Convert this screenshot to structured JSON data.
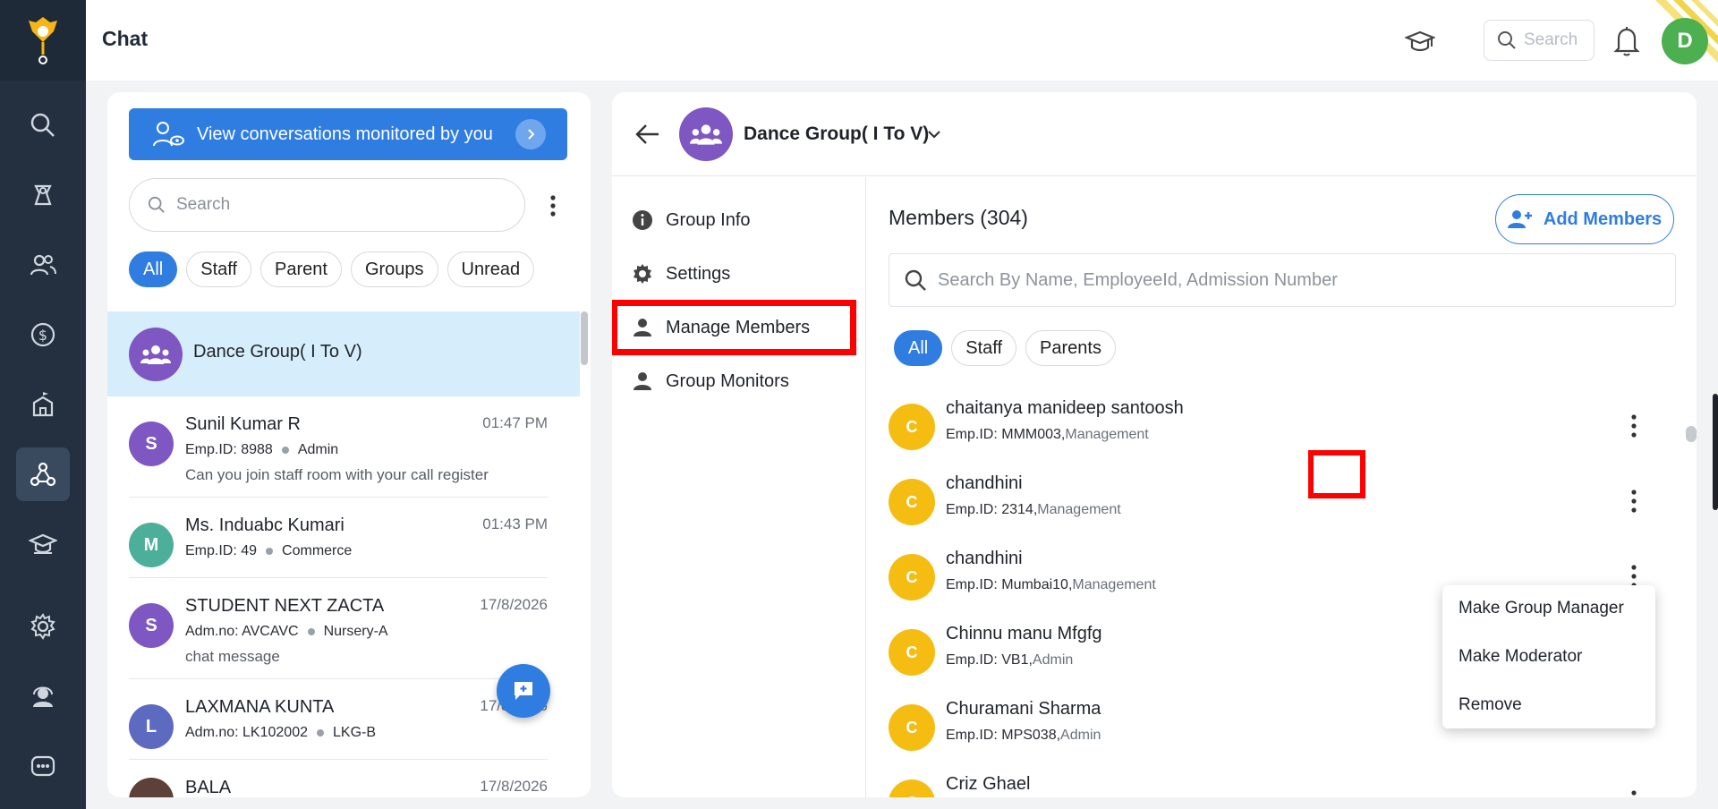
{
  "app": {
    "title": "Chat"
  },
  "topbar": {
    "search_placeholder": "Search",
    "avatar_letter": "D"
  },
  "rail": {
    "icons": [
      "search-icon",
      "study-icon",
      "people-icon",
      "finance-icon",
      "school-icon",
      "chat-network-icon",
      "graduation-icon",
      "settings-icon",
      "support-icon",
      "more-icon"
    ]
  },
  "chat_panel": {
    "monitor_label": "View conversations monitored by you",
    "search_placeholder": "Search",
    "filters": [
      "All",
      "Staff",
      "Parent",
      "Groups",
      "Unread"
    ],
    "items": [
      {
        "name": "Dance Group( I To V)",
        "selected": true
      },
      {
        "initial": "S",
        "name": "Sunil Kumar R",
        "id": "Emp.ID: 8988",
        "tag": "Admin",
        "message": "Can you join staff room with your call register",
        "time": "01:47 PM",
        "color": "#7e57c2"
      },
      {
        "initial": "M",
        "name": "Ms. Induabc Kumari",
        "id": "Emp.ID: 49",
        "tag": "Commerce",
        "message": "",
        "time": "01:43 PM",
        "color": "#4caf9a"
      },
      {
        "initial": "S",
        "name": "STUDENT NEXT ZACTA",
        "id": "Adm.no: AVCAVC",
        "tag": "Nursery-A",
        "message": "chat message",
        "time": "17/8/2026",
        "color": "#7e57c2"
      },
      {
        "initial": "L",
        "name": "LAXMANA KUNTA",
        "id": "Adm.no: LK102002",
        "tag": "LKG-B",
        "message": "",
        "time": "17/8/2026",
        "color": "#5c6bc0"
      },
      {
        "initial": "",
        "name": "BALA",
        "id": "",
        "tag": "",
        "message": "",
        "time": "17/8/2026",
        "color": "#5d4037"
      }
    ]
  },
  "group": {
    "title": "Dance Group( I To V)",
    "menu": [
      "Group Info",
      "Settings",
      "Manage Members",
      "Group Monitors"
    ],
    "members_title": "Members (304)",
    "add_members": "Add Members",
    "search_placeholder": "Search By Name, EmployeeId, Admission Number",
    "filters": [
      "All",
      "Staff",
      "Parents"
    ],
    "members": [
      {
        "initial": "C",
        "name": "chaitanya manideep santoosh",
        "id": "Emp.ID: MMM003,",
        "role": "Management"
      },
      {
        "initial": "C",
        "name": "chandhini",
        "id": "Emp.ID: 2314,",
        "role": "Management"
      },
      {
        "initial": "C",
        "name": "chandhini",
        "id": "Emp.ID: Mumbai10,",
        "role": "Management"
      },
      {
        "initial": "C",
        "name": "Chinnu manu Mfgfg",
        "id": "Emp.ID: VB1,",
        "role": "Admin"
      },
      {
        "initial": "C",
        "name": "Churamani Sharma",
        "id": "Emp.ID: MPS038,",
        "role": "Admin"
      },
      {
        "initial": "C",
        "name": "Criz Ghael",
        "id": "",
        "role": ""
      }
    ],
    "dropdown": [
      "Make Group Manager",
      "Make Moderator",
      "Remove"
    ]
  },
  "colors": {
    "accent": "#2f7de1",
    "rail": "#243040",
    "member_avatar": "#f5bd12",
    "highlight": "#ff0000"
  }
}
